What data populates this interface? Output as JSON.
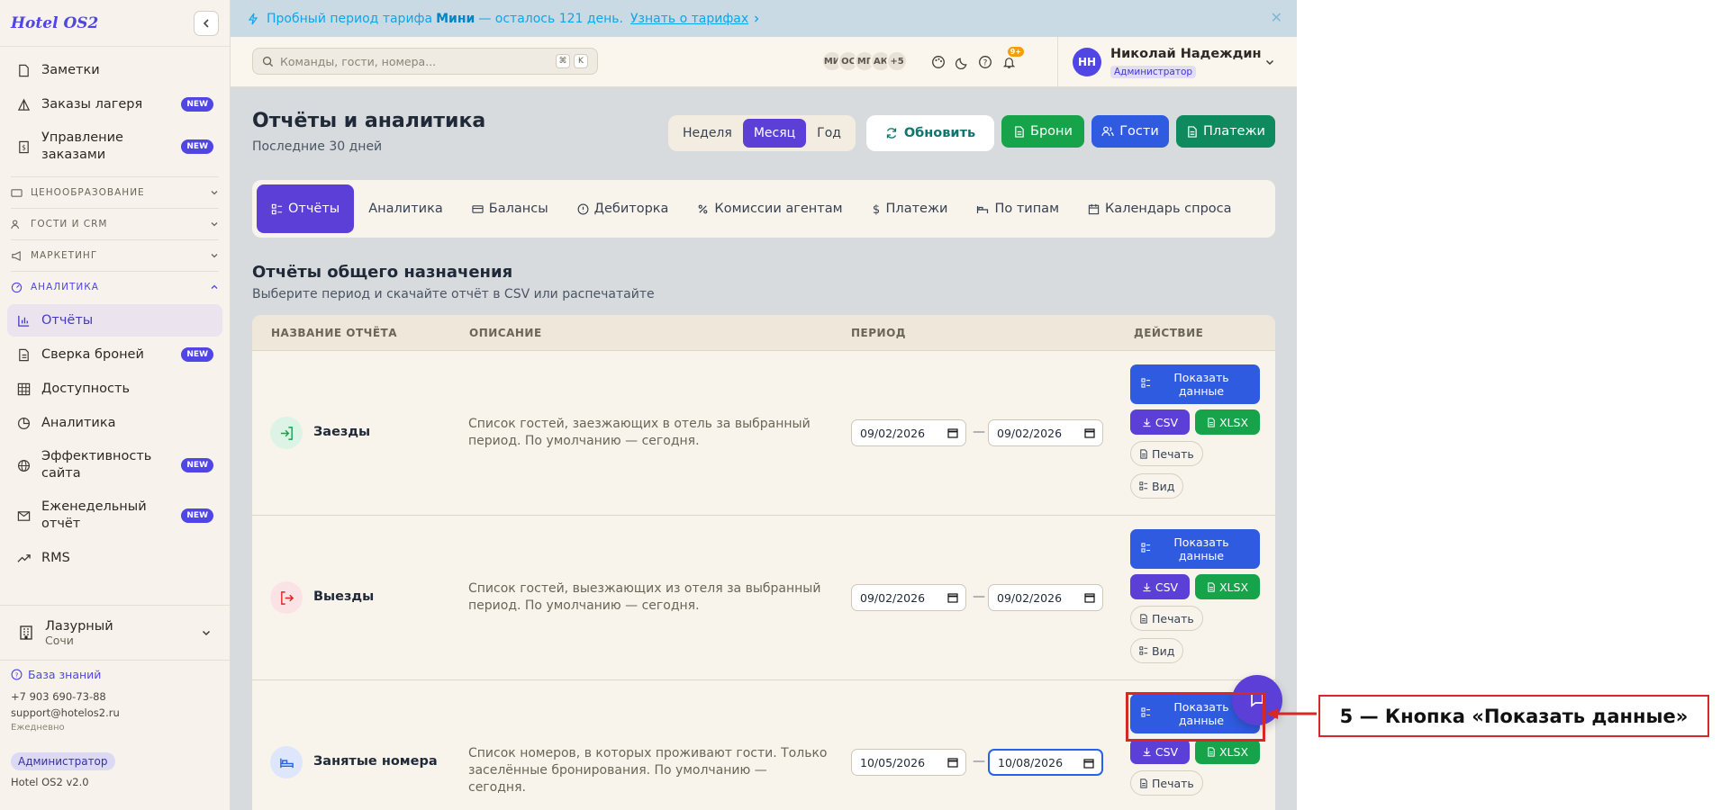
{
  "sidebar": {
    "brand": "Hotel OS2",
    "items_top": [
      {
        "label": "Заметки",
        "badge": ""
      },
      {
        "label": "Заказы лагеря",
        "badge": "NEW"
      },
      {
        "label": "Управление заказами",
        "badge": "NEW"
      }
    ],
    "sections": [
      {
        "label": "ЦЕНООБРАЗОВАНИЕ"
      },
      {
        "label": "ГОСТИ И CRM"
      },
      {
        "label": "МАРКЕТИНГ"
      },
      {
        "label": "АНАЛИТИКА"
      }
    ],
    "analytics_items": [
      {
        "label": "Отчёты",
        "badge": ""
      },
      {
        "label": "Сверка броней",
        "badge": "NEW"
      },
      {
        "label": "Доступность",
        "badge": ""
      },
      {
        "label": "Аналитика",
        "badge": ""
      },
      {
        "label": "Эффективность сайта",
        "badge": "NEW"
      },
      {
        "label": "Еженедельный отчёт",
        "badge": "NEW"
      },
      {
        "label": "RMS",
        "badge": ""
      }
    ],
    "hotel_name": "Лазурный",
    "hotel_city": "Сочи",
    "knowledge_base": "База знаний",
    "phone": "+7 903 690-73-88",
    "email": "support@hotelos2.ru",
    "schedule": "Ежедневно",
    "role": "Администратор",
    "version": "Hotel OS2 v2.0"
  },
  "banner": {
    "prefix": "Пробный период тарифа",
    "plan": "Мини",
    "suffix": "— осталось 121 день.",
    "link": "Узнать о тарифах"
  },
  "topbar": {
    "search_placeholder": "Команды, гости, номера...",
    "kbd1": "⌘",
    "kbd2": "K",
    "avatars": [
      "МИ",
      "ОС",
      "МГ",
      "АК"
    ],
    "avatars_more": "+5",
    "notif_count": "9+",
    "user_initials": "НН",
    "user_name": "Николай Надеждин",
    "user_role": "Администратор"
  },
  "page": {
    "title": "Отчёты и аналитика",
    "subtitle": "Последние 30 дней",
    "periods": [
      "Неделя",
      "Месяц",
      "Год"
    ],
    "active_period": "Месяц",
    "refresh": "Обновить",
    "btn_bookings": "Брони",
    "btn_guests": "Гости",
    "btn_payments": "Платежи",
    "tabs": [
      "Отчёты",
      "Аналитика",
      "Балансы",
      "Дебиторка",
      "Комиссии агентам",
      "Платежи",
      "По типам",
      "Календарь спроса"
    ],
    "section_title": "Отчёты общего назначения",
    "section_sub": "Выберите период и скачайте отчёт в CSV или распечатайте"
  },
  "table": {
    "headers": [
      "НАЗВАНИЕ ОТЧЁТА",
      "ОПИСАНИЕ",
      "ПЕРИОД",
      "ДЕЙСТВИЕ"
    ],
    "rows": [
      {
        "name": "Заезды",
        "desc": "Список гостей, заезжающих в отель за выбранный период. По умолчанию — сегодня.",
        "from": "09/02/2026",
        "to": "09/02/2026"
      },
      {
        "name": "Выезды",
        "desc": "Список гостей, выезжающих из отеля за выбранный период. По умолчанию — сегодня.",
        "from": "09/02/2026",
        "to": "09/02/2026"
      },
      {
        "name": "Занятые номера",
        "desc": "Список номеров, в которых проживают гости. Только заселённые бронирования. По умолчанию — сегодня.",
        "from": "10/05/2026",
        "to": "10/08/2026"
      }
    ],
    "actions": {
      "show": "Показать данные",
      "csv": "CSV",
      "xlsx": "XLSX",
      "print": "Печать",
      "view": "Вид"
    }
  },
  "annotation": {
    "label": "5 — Кнопка «Показать данные»"
  },
  "colors": {
    "accent": "#5b3fd6",
    "blue": "#2f5be0",
    "green": "#16a34a",
    "annotation": "#d62828"
  }
}
